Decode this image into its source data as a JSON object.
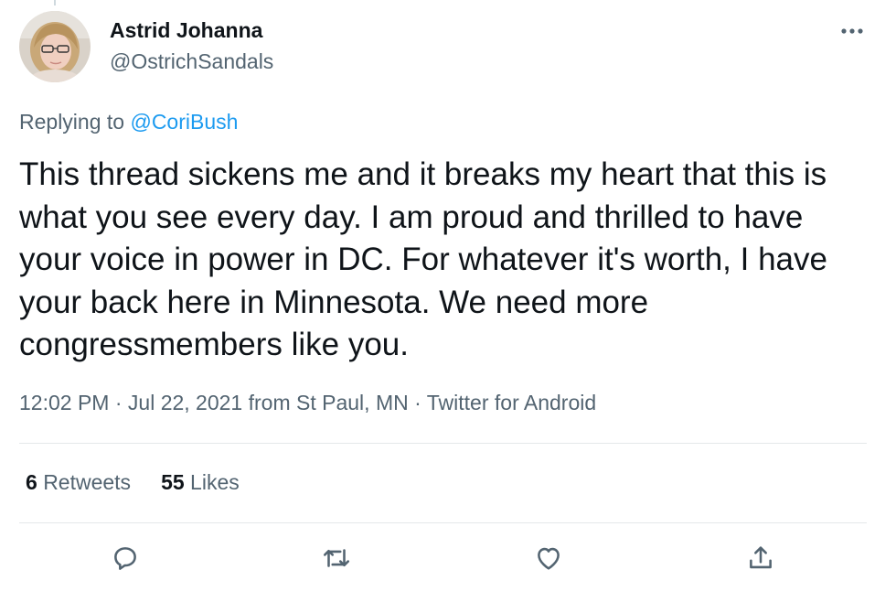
{
  "author": {
    "display_name": "Astrid Johanna",
    "handle": "@OstrichSandals",
    "avatar_icon": "profile-photo"
  },
  "reply": {
    "prefix": "Replying to",
    "mention": "@CoriBush"
  },
  "tweet": {
    "text": "This thread sickens me and it breaks my heart that this is\nwhat you see every day. I am proud and thrilled to have\nyour voice in power in DC. For whatever it's worth, I have\nyour back here in Minnesota. We need more\ncongressmembers like you."
  },
  "meta": {
    "time": "12:02 PM",
    "separator": "·",
    "date": "Jul 22, 2021",
    "location": "from St Paul, MN",
    "source": "Twitter for Android"
  },
  "stats": {
    "retweets_count": "6",
    "retweets_label": "Retweets",
    "likes_count": "55",
    "likes_label": "Likes"
  },
  "actions": {
    "icons": [
      "reply-icon",
      "retweet-icon",
      "like-icon",
      "share-icon"
    ]
  },
  "colors": {
    "text": "#0f1419",
    "secondary": "#536471",
    "link": "#1d9bf0",
    "divider": "#e4e8ea"
  }
}
